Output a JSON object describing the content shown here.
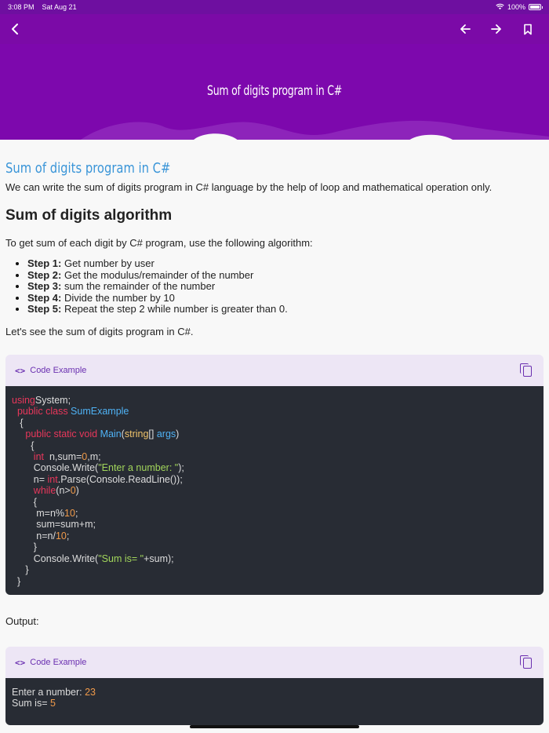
{
  "status": {
    "time": "3:08 PM",
    "date": "Sat Aug 21",
    "battery": "100%",
    "battery_level": 1.0
  },
  "hero": {
    "title": "Sum of digits program in C#"
  },
  "article": {
    "heading": "Sum of digits program in C#",
    "intro": "We can write the sum of digits program in C# language by the help of loop and mathematical operation only.",
    "algo_heading": "Sum of digits algorithm",
    "algo_intro": "To get sum of each digit by C# program, use the following algorithm:",
    "steps": [
      {
        "label": "Step 1:",
        "text": " Get number by user"
      },
      {
        "label": "Step 2:",
        "text": " Get the modulus/remainder of the number"
      },
      {
        "label": "Step 3:",
        "text": " sum the remainder of the number"
      },
      {
        "label": "Step 4:",
        "text": " Divide the number by 10"
      },
      {
        "label": "Step 5:",
        "text": " Repeat the step 2 while number is greater than 0."
      }
    ],
    "lets_see": "Let's see the sum of digits program in C#.",
    "output_label": "Output:"
  },
  "code_blocks": [
    {
      "header": "Code Example",
      "lines": [
        [
          [
            "kw",
            "using"
          ],
          [
            "",
            "System;"
          ]
        ],
        [
          [
            "",
            "  "
          ],
          [
            "kw",
            "public class"
          ],
          [
            "",
            ""
          ],
          [
            "cls",
            " SumExample"
          ]
        ],
        [
          [
            "",
            "   {"
          ]
        ],
        [
          [
            "",
            "     "
          ],
          [
            "kw",
            "public static void"
          ],
          [
            "fn",
            " Main"
          ],
          [
            "",
            "("
          ],
          [
            "ty",
            "string"
          ],
          [
            "",
            "[] "
          ],
          [
            "cls",
            "args"
          ],
          [
            "",
            ")"
          ]
        ],
        [
          [
            "",
            "       {"
          ]
        ],
        [
          [
            "",
            "        "
          ],
          [
            "kw",
            "int"
          ],
          [
            "",
            "  n,sum="
          ],
          [
            "num",
            "0"
          ],
          [
            "",
            ",m;"
          ]
        ],
        [
          [
            "",
            "        Console.Write("
          ],
          [
            "str",
            "\"Enter a number: \""
          ],
          [
            "",
            ");"
          ]
        ],
        [
          [
            "",
            "        n= "
          ],
          [
            "kw",
            "int"
          ],
          [
            "",
            ".Parse(Console.ReadLine());"
          ]
        ],
        [
          [
            "",
            "        "
          ],
          [
            "kw",
            "while"
          ],
          [
            "",
            "(n>"
          ],
          [
            "num",
            "0"
          ],
          [
            "",
            ")"
          ]
        ],
        [
          [
            "",
            "        {"
          ]
        ],
        [
          [
            "",
            "         m=n%"
          ],
          [
            "num",
            "10"
          ],
          [
            "",
            ";"
          ]
        ],
        [
          [
            "",
            "         sum=sum+m;"
          ]
        ],
        [
          [
            "",
            "         n=n/"
          ],
          [
            "num",
            "10"
          ],
          [
            "",
            ";"
          ]
        ],
        [
          [
            "",
            "        }"
          ]
        ],
        [
          [
            "",
            "        Console.Write("
          ],
          [
            "str",
            "\"Sum is= \""
          ],
          [
            "",
            "+sum);"
          ]
        ],
        [
          [
            "",
            "     }"
          ]
        ],
        [
          [
            "",
            "  }"
          ]
        ]
      ]
    },
    {
      "header": "Code Example",
      "lines": [
        [
          [
            "",
            "Enter a number: "
          ],
          [
            "num",
            "23"
          ]
        ],
        [
          [
            "",
            "Sum is= "
          ],
          [
            "num",
            "5"
          ]
        ]
      ]
    }
  ]
}
